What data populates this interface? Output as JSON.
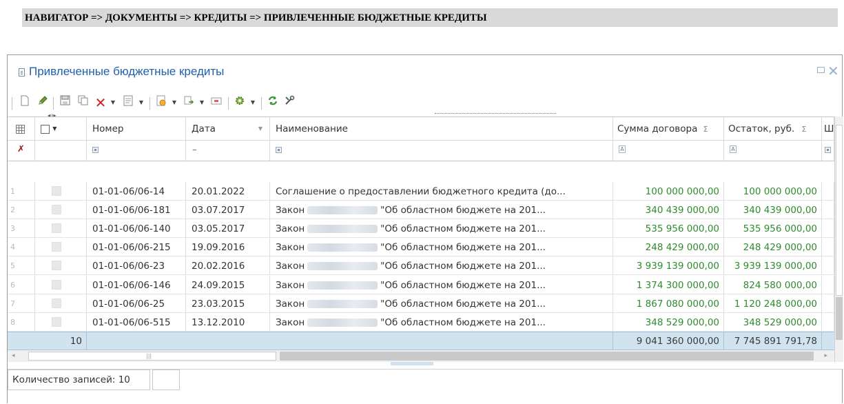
{
  "nav": {
    "breadcrumb": "НАВИГАТОР => ДОКУМЕНТЫ => КРЕДИТЫ => ПРИВЛЕЧЕННЫЕ БЮДЖЕТНЫЕ КРЕДИТЫ"
  },
  "window": {
    "title": "Привлеченные бюджетные кредиты",
    "icon": "document-icon"
  },
  "toolbar": {
    "icons": [
      "new-document-icon",
      "edit-pencil-icon",
      "save-icon",
      "copy-icon",
      "delete-icon",
      "dropdown-arrow",
      "document-list-icon",
      "dropdown-arrow",
      "report-icon",
      "dropdown-arrow",
      "import-icon",
      "dropdown-arrow",
      "print-icon",
      "settings-gear-icon",
      "dropdown-arrow",
      "refresh-icon",
      "tools-icon"
    ]
  },
  "grid": {
    "columns": [
      "Номер",
      "Дата",
      "Наименование",
      "Сумма договора",
      "Остаток, руб.",
      "Ш"
    ],
    "sum_symbol": "Σ",
    "date_filter_value": "–",
    "rows": [
      {
        "idx": "1",
        "number": "01-01-06/06-14",
        "date": "20.01.2022",
        "name_pre": "Соглашение о предоставлении бюджетного кредита (до...",
        "name_post": "",
        "blur": false,
        "sum": "100 000 000,00",
        "rest": "100 000 000,00"
      },
      {
        "idx": "2",
        "number": "01-01-06/06-181",
        "date": "03.07.2017",
        "name_pre": "Закон",
        "name_post": "\"Об областном бюджете на 201...",
        "blur": true,
        "sum": "340 439 000,00",
        "rest": "340 439 000,00"
      },
      {
        "idx": "3",
        "number": "01-01-06/06-140",
        "date": "03.05.2017",
        "name_pre": "Закон",
        "name_post": "\"Об областном бюджете на 201...",
        "blur": true,
        "sum": "535 956 000,00",
        "rest": "535 956 000,00"
      },
      {
        "idx": "4",
        "number": "01-01-06/06-215",
        "date": "19.09.2016",
        "name_pre": "Закон",
        "name_post": "\"Об областном бюджете на 201...",
        "blur": true,
        "sum": "248 429 000,00",
        "rest": "248 429 000,00"
      },
      {
        "idx": "5",
        "number": "01-01-06/06-23",
        "date": "20.02.2016",
        "name_pre": "Закон",
        "name_post": "\"Об областном бюджете на 201...",
        "blur": true,
        "sum": "3 939 139 000,00",
        "rest": "3 939 139 000,00"
      },
      {
        "idx": "6",
        "number": "01-01-06/06-146",
        "date": "24.09.2015",
        "name_pre": "Закон",
        "name_post": "\"Об областном бюджете на 201...",
        "blur": true,
        "sum": "1 374 300 000,00",
        "rest": "824 580 000,00"
      },
      {
        "idx": "7",
        "number": "01-01-06/06-25",
        "date": "23.03.2015",
        "name_pre": "Закон",
        "name_post": "\"Об областном бюджете на 201...",
        "blur": true,
        "sum": "1 867 080 000,00",
        "rest": "1 120 248 000,00"
      },
      {
        "idx": "8",
        "number": "01-01-06/06-515",
        "date": "13.12.2010",
        "name_pre": "Закон",
        "name_post": "\"Об областном бюджете на 201...",
        "blur": true,
        "sum": "348 529 000,00",
        "rest": "348 529 000,00"
      }
    ],
    "totals": {
      "count": "10",
      "sum": "9 041 360 000,00",
      "rest": "7 745 891 791,78"
    }
  },
  "status": {
    "records": "Количество записей: 10"
  },
  "colors": {
    "accent": "#1f5fae",
    "money": "#2e8b2e",
    "total_bg": "#d2e3f0",
    "nav_bg": "#d9d9d9"
  }
}
